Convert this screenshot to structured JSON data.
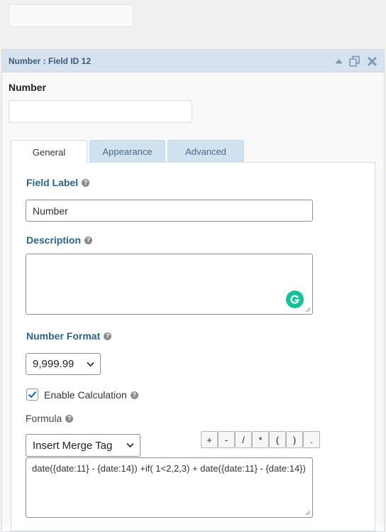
{
  "panel": {
    "title": "Number : Field ID 12",
    "icons": [
      "collapse-arrow-icon",
      "duplicate-icon",
      "close-icon"
    ]
  },
  "preview": {
    "label": "Number",
    "value": ""
  },
  "tabs": [
    {
      "label": "General",
      "active": true
    },
    {
      "label": "Appearance",
      "active": false
    },
    {
      "label": "Advanced",
      "active": false
    }
  ],
  "general": {
    "field_label": {
      "label": "Field Label",
      "value": "Number"
    },
    "description": {
      "label": "Description",
      "value": ""
    },
    "number_format": {
      "label": "Number Format",
      "selected": "9,999.99"
    },
    "enable_calculation": {
      "label": "Enable Calculation",
      "checked": true
    },
    "formula": {
      "label": "Formula",
      "merge_tag_select": "Insert Merge Tag",
      "operators": [
        "+",
        "-",
        "/",
        "*",
        "(",
        ")",
        "."
      ],
      "value": "date({date:11} - {date:14}) +if( 1<2,2,3) + date({date:11} - {date:14})"
    }
  },
  "colors": {
    "header_bg": "#d6e3ef",
    "section_label": "#2c6488",
    "tab_inactive_bg": "#d0e1f0",
    "checkbox_accent": "#2271b1",
    "grammarly": "#15c39a"
  }
}
